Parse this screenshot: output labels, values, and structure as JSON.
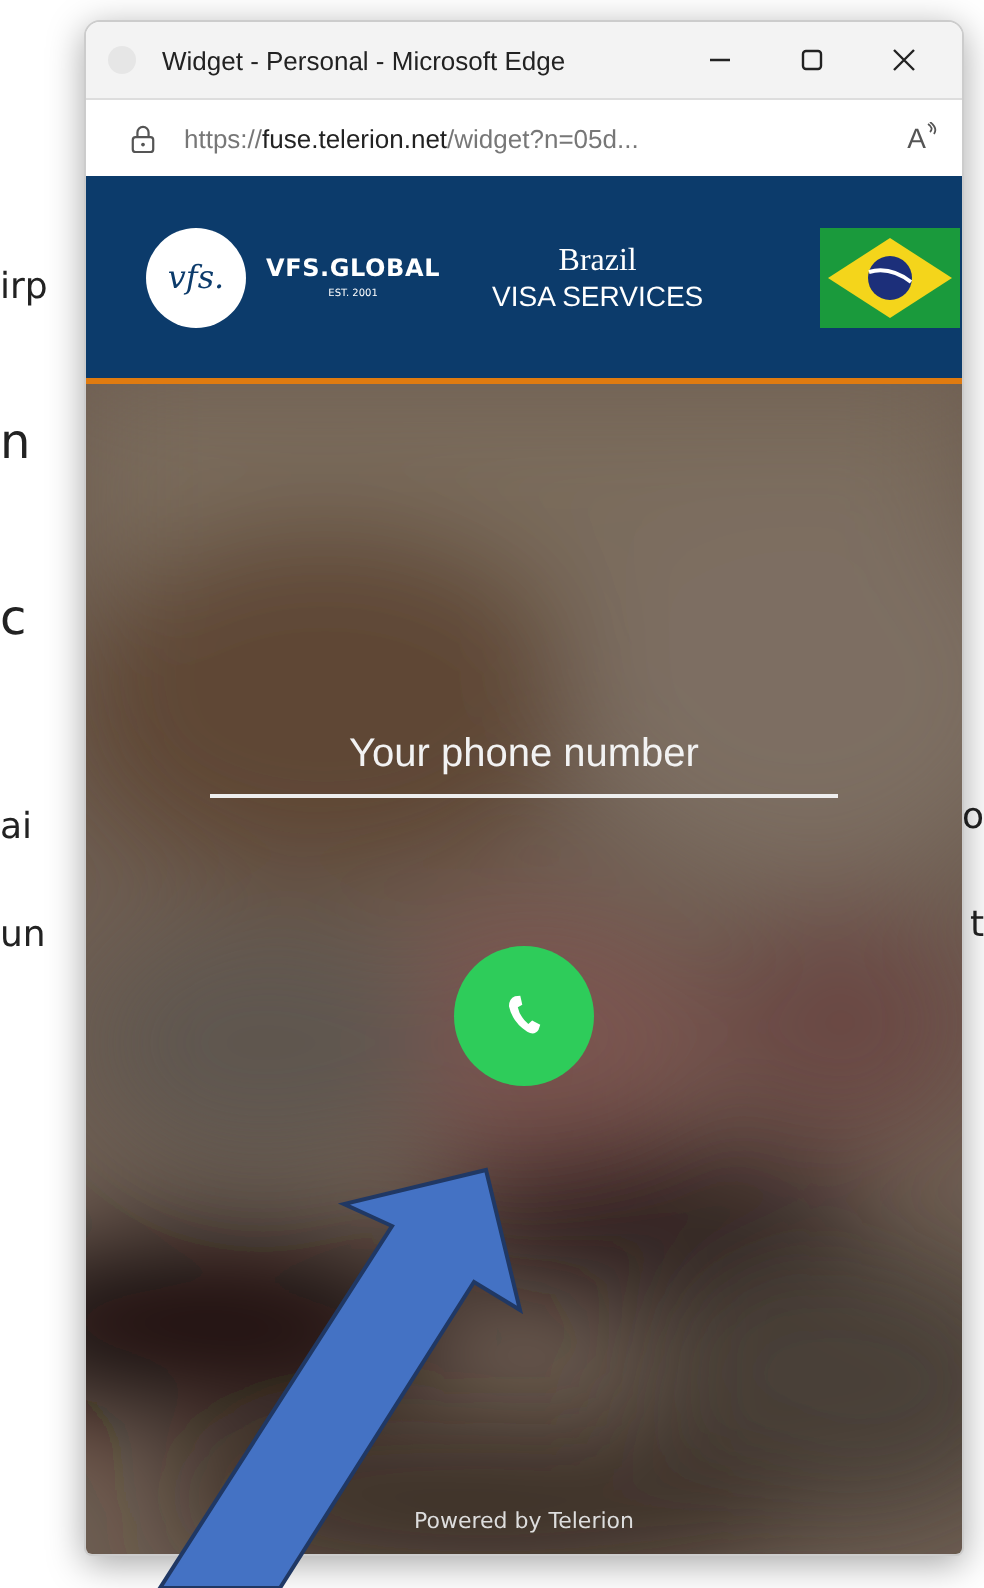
{
  "background_text": {
    "left": [
      "irp",
      "n",
      "c",
      "ai",
      "un"
    ],
    "right": [
      "o",
      "t"
    ]
  },
  "window": {
    "title": "Widget - Personal - Microsoft Edge"
  },
  "address_bar": {
    "url_prefix": "https://",
    "url_domain": "fuse.telerion.net",
    "url_rest": "/widget?n=05d...",
    "read_aloud": "A"
  },
  "header": {
    "logo_mark": "vfs.",
    "brand": "VFS.GLOBAL",
    "brand_sub": "EST. 2001",
    "title": "Brazil",
    "subtitle": "VISA SERVICES"
  },
  "form": {
    "phone": {
      "placeholder": "Your phone number"
    }
  },
  "footer": "Powered by Telerion"
}
